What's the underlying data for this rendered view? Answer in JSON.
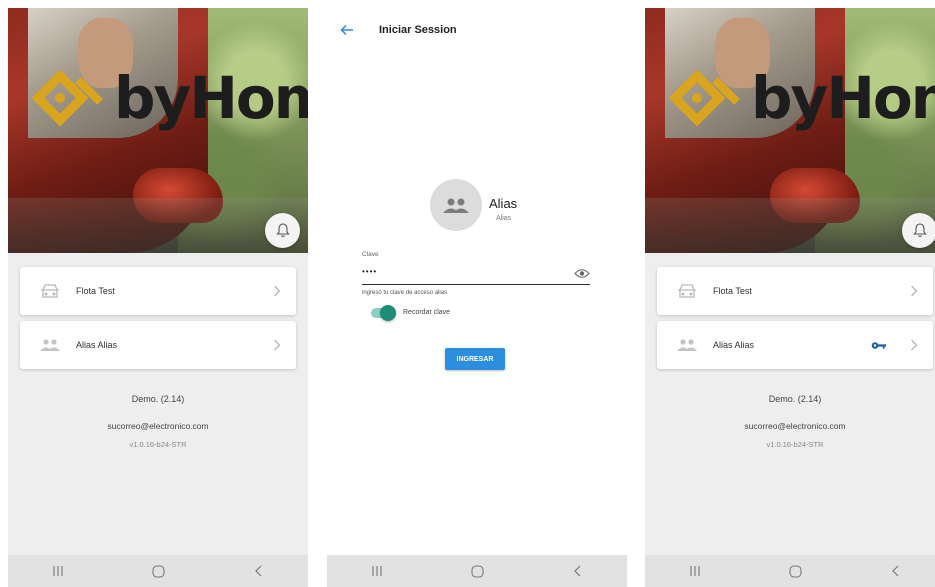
{
  "home": {
    "logo_text": "byHom",
    "items": [
      {
        "label": "Flota Test",
        "icon": "car-icon"
      },
      {
        "label": "Alias Alias",
        "icon": "group-icon"
      }
    ],
    "demo": "Demo. (2.14)",
    "email": "sucorreo@electronico.com",
    "version": "v1.0.16-b24-STR"
  },
  "login": {
    "title": "Iniciar Session",
    "alias_name": "Alias",
    "alias_sub": "Alias",
    "field_label": "Clave",
    "field_value": "••••",
    "field_help": "ingresó tu clave de acceso alias",
    "remember_label": "Recordar clave",
    "remember_on": true,
    "submit_label": "INGRESAR"
  },
  "colors": {
    "accent": "#2d8ee0",
    "toggle": "#1e8c76",
    "logo_mark": "#d9a51e",
    "key": "#1f5fb0"
  }
}
